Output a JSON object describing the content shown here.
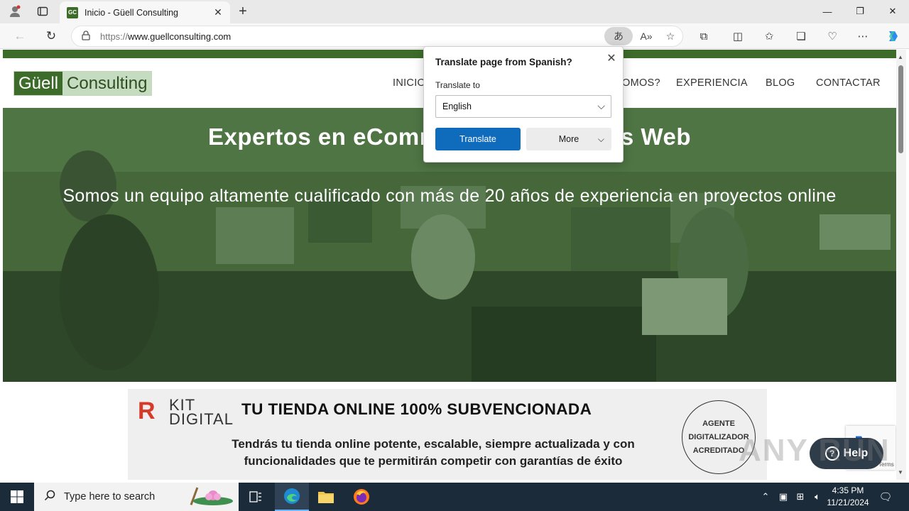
{
  "browser": {
    "tab_title": "Inicio - Güell Consulting",
    "favicon_text": "GC",
    "url_scheme": "https://",
    "url_rest": "www.guellconsulting.com"
  },
  "site": {
    "logo_part1": "Güell",
    "logo_part2": "Consulting",
    "menu": [
      "INICIO",
      "¿QUIÉNES SOMOS?",
      "EXPERIENCIA",
      "BLOG",
      "CONTACTAR"
    ],
    "menu_visible": [
      "INICIO",
      "OMOS?",
      "EXPERIENCIA",
      "BLOG",
      "CONTACTAR"
    ],
    "hero_title": "Expertos en eCommerce y Proyectos Web",
    "hero_subtitle": "Somos un equipo altamente cualificado con más de 20 años de experiencia en proyectos online"
  },
  "banner": {
    "kit_line1": "KIT",
    "kit_line2": "DIGITAL",
    "title": "TU TIENDA ONLINE 100% SUBVENCIONADA",
    "text": "Tendrás tu tienda online potente, escalable, siempre actualizada y con funcionalidades que te permitirán competir con garantías de éxito",
    "badge": "AGENTE DIGITALIZADOR ACREDITADO"
  },
  "widgets": {
    "help_label": "Help",
    "recaptcha_text": "Terms",
    "watermark": "ANY RUN"
  },
  "translate_popup": {
    "title": "Translate page from Spanish?",
    "label": "Translate to",
    "selected_language": "English",
    "translate_button": "Translate",
    "more_button": "More"
  },
  "taskbar": {
    "search_placeholder": "Type here to search",
    "time": "4:35 PM",
    "date": "11/21/2024"
  },
  "colors": {
    "brand_green": "#3d6b2a",
    "translate_blue": "#0f6cbd",
    "taskbar": "#1c2b3a"
  }
}
